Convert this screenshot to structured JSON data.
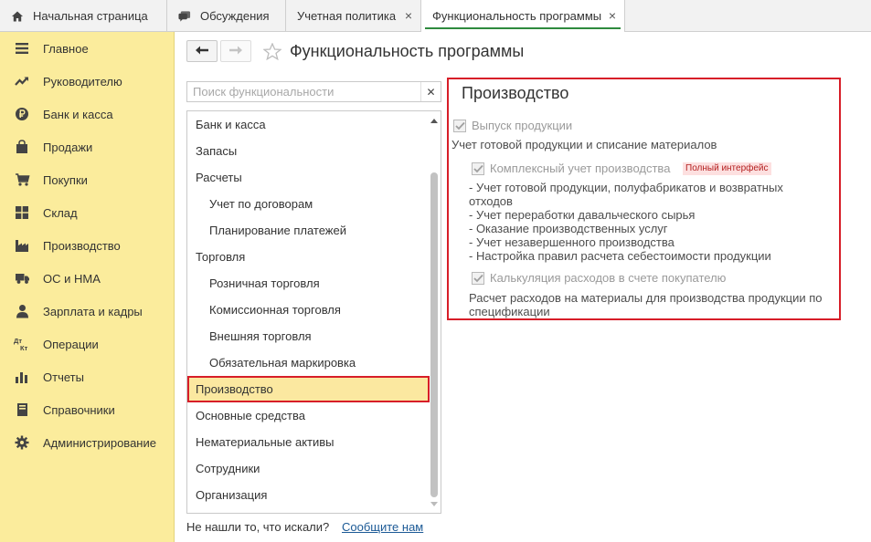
{
  "tabs": [
    {
      "label": "Начальная страница",
      "icon": "home-icon"
    },
    {
      "label": "Обсуждения",
      "icon": "chat-icon"
    },
    {
      "label": "Учетная политика",
      "closable": true
    },
    {
      "label": "Функциональность программы",
      "closable": true,
      "active": true
    }
  ],
  "sidebar": {
    "items": [
      {
        "label": "Главное",
        "icon": "menu-lines-icon"
      },
      {
        "label": "Руководителю",
        "icon": "trend-chart-icon"
      },
      {
        "label": "Банк и касса",
        "icon": "ruble-icon"
      },
      {
        "label": "Продажи",
        "icon": "shopping-bag-icon"
      },
      {
        "label": "Покупки",
        "icon": "shopping-cart-icon"
      },
      {
        "label": "Склад",
        "icon": "warehouse-grid-icon"
      },
      {
        "label": "Производство",
        "icon": "factory-icon"
      },
      {
        "label": "ОС и НМА",
        "icon": "truck-icon"
      },
      {
        "label": "Зарплата и кадры",
        "icon": "person-icon"
      },
      {
        "label": "Операции",
        "icon": "dt-kt-icon"
      },
      {
        "label": "Отчеты",
        "icon": "bar-chart-icon"
      },
      {
        "label": "Справочники",
        "icon": "book-icon"
      },
      {
        "label": "Администрирование",
        "icon": "gear-icon"
      }
    ]
  },
  "header": {
    "title": "Функциональность программы"
  },
  "search": {
    "placeholder": "Поиск функциональности",
    "value": ""
  },
  "sections": [
    {
      "label": "Банк и касса",
      "level": 0
    },
    {
      "label": "Запасы",
      "level": 0
    },
    {
      "label": "Расчеты",
      "level": 0
    },
    {
      "label": "Учет по договорам",
      "level": 1
    },
    {
      "label": "Планирование платежей",
      "level": 1
    },
    {
      "label": "Торговля",
      "level": 0
    },
    {
      "label": "Розничная торговля",
      "level": 1
    },
    {
      "label": "Комиссионная торговля",
      "level": 1
    },
    {
      "label": "Внешняя торговля",
      "level": 1
    },
    {
      "label": "Обязательная маркировка",
      "level": 1
    },
    {
      "label": "Производство",
      "level": 0,
      "selected": true
    },
    {
      "label": "Основные средства",
      "level": 0
    },
    {
      "label": "Нематериальные активы",
      "level": 0
    },
    {
      "label": "Сотрудники",
      "level": 0
    },
    {
      "label": "Организация",
      "level": 0
    }
  ],
  "footer": {
    "text": "Не нашли то, что искали?",
    "link": "Сообщите нам"
  },
  "panel": {
    "title": "Производство",
    "output": {
      "label": "Выпуск продукции",
      "checked": true,
      "description": "Учет готовой продукции и списание материалов"
    },
    "complex": {
      "label": "Комплексный учет производства",
      "badge": "Полный интерфейс",
      "checked": true,
      "lines": [
        "- Учет готовой продукции, полуфабрикатов и возвратных отходов",
        "- Учет переработки давальческого сырья",
        "- Оказание производственных услуг",
        "- Учет незавершенного производства",
        "- Настройка правил расчета себестоимости продукции"
      ]
    },
    "calc": {
      "label": "Калькуляция расходов в счете покупателю",
      "checked": true,
      "description": "Расчет расходов на материалы для производства продукции по спецификации"
    }
  },
  "colors": {
    "sidebar_bg": "#fbec9c",
    "selection_bg": "#fbe8a0",
    "highlight_border": "#d71e28",
    "link": "#1c5a96",
    "active_tab_underline": "#2e8a3e"
  }
}
